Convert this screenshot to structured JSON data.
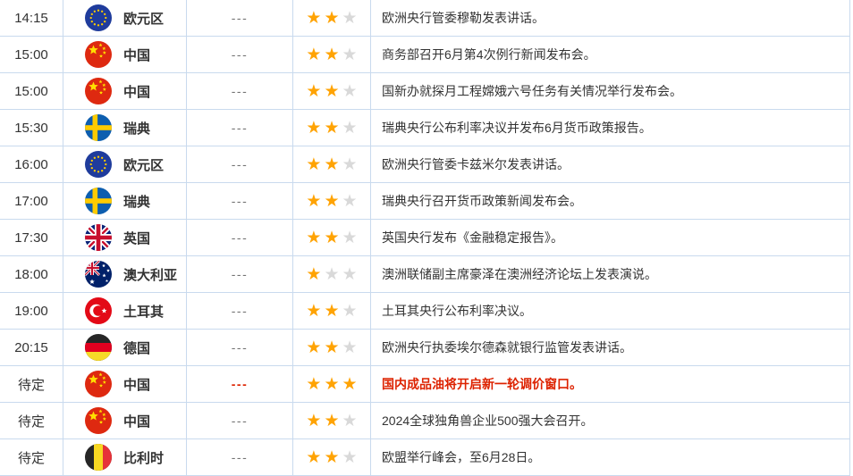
{
  "table": {
    "rows": [
      {
        "time": "14:15",
        "country": "欧元区",
        "flag": "eu",
        "value": "---",
        "stars": 2,
        "event": "欧洲央行管委穆勒发表讲话。",
        "highlight": false
      },
      {
        "time": "15:00",
        "country": "中国",
        "flag": "cn",
        "value": "---",
        "stars": 2,
        "event": "商务部召开6月第4次例行新闻发布会。",
        "highlight": false
      },
      {
        "time": "15:00",
        "country": "中国",
        "flag": "cn",
        "value": "---",
        "stars": 2,
        "event": "国新办就探月工程嫦娥六号任务有关情况举行发布会。",
        "highlight": false
      },
      {
        "time": "15:30",
        "country": "瑞典",
        "flag": "se",
        "value": "---",
        "stars": 2,
        "event": "瑞典央行公布利率决议并发布6月货币政策报告。",
        "highlight": false
      },
      {
        "time": "16:00",
        "country": "欧元区",
        "flag": "eu",
        "value": "---",
        "stars": 2,
        "event": "欧洲央行管委卡兹米尔发表讲话。",
        "highlight": false
      },
      {
        "time": "17:00",
        "country": "瑞典",
        "flag": "se",
        "value": "---",
        "stars": 2,
        "event": "瑞典央行召开货币政策新闻发布会。",
        "highlight": false
      },
      {
        "time": "17:30",
        "country": "英国",
        "flag": "gb",
        "value": "---",
        "stars": 2,
        "event": "英国央行发布《金融稳定报告》。",
        "highlight": false
      },
      {
        "time": "18:00",
        "country": "澳大利亚",
        "flag": "au",
        "value": "---",
        "stars": 1,
        "event": "澳洲联储副主席豪泽在澳洲经济论坛上发表演说。",
        "highlight": false
      },
      {
        "time": "19:00",
        "country": "土耳其",
        "flag": "tr",
        "value": "---",
        "stars": 2,
        "event": "土耳其央行公布利率决议。",
        "highlight": false
      },
      {
        "time": "20:15",
        "country": "德国",
        "flag": "de",
        "value": "---",
        "stars": 2,
        "event": "欧洲央行执委埃尔德森就银行监管发表讲话。",
        "highlight": false
      },
      {
        "time": "待定",
        "country": "中国",
        "flag": "cn",
        "value": "---",
        "stars": 3,
        "event": "国内成品油将开启新一轮调价窗口。",
        "highlight": true
      },
      {
        "time": "待定",
        "country": "中国",
        "flag": "cn",
        "value": "---",
        "stars": 2,
        "event": "2024全球独角兽企业500强大会召开。",
        "highlight": false
      },
      {
        "time": "待定",
        "country": "比利时",
        "flag": "be",
        "value": "---",
        "stars": 2,
        "event": "欧盟举行峰会，至6月28日。",
        "highlight": false
      }
    ]
  },
  "icons": {
    "star": "★"
  },
  "colors": {
    "border": "#c9daee",
    "text": "#333333",
    "value_text": "#737373",
    "star_active": "#ffa303",
    "star_inactive": "#d9d9d9",
    "highlight": "#dd2200"
  }
}
